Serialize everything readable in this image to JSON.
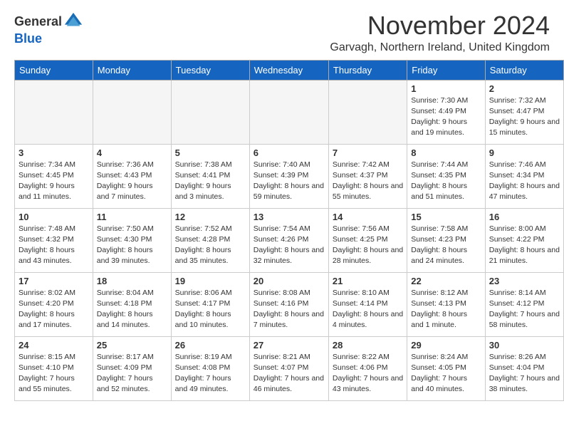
{
  "logo": {
    "general": "General",
    "blue": "Blue"
  },
  "title": "November 2024",
  "location": "Garvagh, Northern Ireland, United Kingdom",
  "days_of_week": [
    "Sunday",
    "Monday",
    "Tuesday",
    "Wednesday",
    "Thursday",
    "Friday",
    "Saturday"
  ],
  "weeks": [
    [
      {
        "day": "",
        "info": ""
      },
      {
        "day": "",
        "info": ""
      },
      {
        "day": "",
        "info": ""
      },
      {
        "day": "",
        "info": ""
      },
      {
        "day": "",
        "info": ""
      },
      {
        "day": "1",
        "info": "Sunrise: 7:30 AM\nSunset: 4:49 PM\nDaylight: 9 hours and 19 minutes."
      },
      {
        "day": "2",
        "info": "Sunrise: 7:32 AM\nSunset: 4:47 PM\nDaylight: 9 hours and 15 minutes."
      }
    ],
    [
      {
        "day": "3",
        "info": "Sunrise: 7:34 AM\nSunset: 4:45 PM\nDaylight: 9 hours and 11 minutes."
      },
      {
        "day": "4",
        "info": "Sunrise: 7:36 AM\nSunset: 4:43 PM\nDaylight: 9 hours and 7 minutes."
      },
      {
        "day": "5",
        "info": "Sunrise: 7:38 AM\nSunset: 4:41 PM\nDaylight: 9 hours and 3 minutes."
      },
      {
        "day": "6",
        "info": "Sunrise: 7:40 AM\nSunset: 4:39 PM\nDaylight: 8 hours and 59 minutes."
      },
      {
        "day": "7",
        "info": "Sunrise: 7:42 AM\nSunset: 4:37 PM\nDaylight: 8 hours and 55 minutes."
      },
      {
        "day": "8",
        "info": "Sunrise: 7:44 AM\nSunset: 4:35 PM\nDaylight: 8 hours and 51 minutes."
      },
      {
        "day": "9",
        "info": "Sunrise: 7:46 AM\nSunset: 4:34 PM\nDaylight: 8 hours and 47 minutes."
      }
    ],
    [
      {
        "day": "10",
        "info": "Sunrise: 7:48 AM\nSunset: 4:32 PM\nDaylight: 8 hours and 43 minutes."
      },
      {
        "day": "11",
        "info": "Sunrise: 7:50 AM\nSunset: 4:30 PM\nDaylight: 8 hours and 39 minutes."
      },
      {
        "day": "12",
        "info": "Sunrise: 7:52 AM\nSunset: 4:28 PM\nDaylight: 8 hours and 35 minutes."
      },
      {
        "day": "13",
        "info": "Sunrise: 7:54 AM\nSunset: 4:26 PM\nDaylight: 8 hours and 32 minutes."
      },
      {
        "day": "14",
        "info": "Sunrise: 7:56 AM\nSunset: 4:25 PM\nDaylight: 8 hours and 28 minutes."
      },
      {
        "day": "15",
        "info": "Sunrise: 7:58 AM\nSunset: 4:23 PM\nDaylight: 8 hours and 24 minutes."
      },
      {
        "day": "16",
        "info": "Sunrise: 8:00 AM\nSunset: 4:22 PM\nDaylight: 8 hours and 21 minutes."
      }
    ],
    [
      {
        "day": "17",
        "info": "Sunrise: 8:02 AM\nSunset: 4:20 PM\nDaylight: 8 hours and 17 minutes."
      },
      {
        "day": "18",
        "info": "Sunrise: 8:04 AM\nSunset: 4:18 PM\nDaylight: 8 hours and 14 minutes."
      },
      {
        "day": "19",
        "info": "Sunrise: 8:06 AM\nSunset: 4:17 PM\nDaylight: 8 hours and 10 minutes."
      },
      {
        "day": "20",
        "info": "Sunrise: 8:08 AM\nSunset: 4:16 PM\nDaylight: 8 hours and 7 minutes."
      },
      {
        "day": "21",
        "info": "Sunrise: 8:10 AM\nSunset: 4:14 PM\nDaylight: 8 hours and 4 minutes."
      },
      {
        "day": "22",
        "info": "Sunrise: 8:12 AM\nSunset: 4:13 PM\nDaylight: 8 hours and 1 minute."
      },
      {
        "day": "23",
        "info": "Sunrise: 8:14 AM\nSunset: 4:12 PM\nDaylight: 7 hours and 58 minutes."
      }
    ],
    [
      {
        "day": "24",
        "info": "Sunrise: 8:15 AM\nSunset: 4:10 PM\nDaylight: 7 hours and 55 minutes."
      },
      {
        "day": "25",
        "info": "Sunrise: 8:17 AM\nSunset: 4:09 PM\nDaylight: 7 hours and 52 minutes."
      },
      {
        "day": "26",
        "info": "Sunrise: 8:19 AM\nSunset: 4:08 PM\nDaylight: 7 hours and 49 minutes."
      },
      {
        "day": "27",
        "info": "Sunrise: 8:21 AM\nSunset: 4:07 PM\nDaylight: 7 hours and 46 minutes."
      },
      {
        "day": "28",
        "info": "Sunrise: 8:22 AM\nSunset: 4:06 PM\nDaylight: 7 hours and 43 minutes."
      },
      {
        "day": "29",
        "info": "Sunrise: 8:24 AM\nSunset: 4:05 PM\nDaylight: 7 hours and 40 minutes."
      },
      {
        "day": "30",
        "info": "Sunrise: 8:26 AM\nSunset: 4:04 PM\nDaylight: 7 hours and 38 minutes."
      }
    ]
  ]
}
